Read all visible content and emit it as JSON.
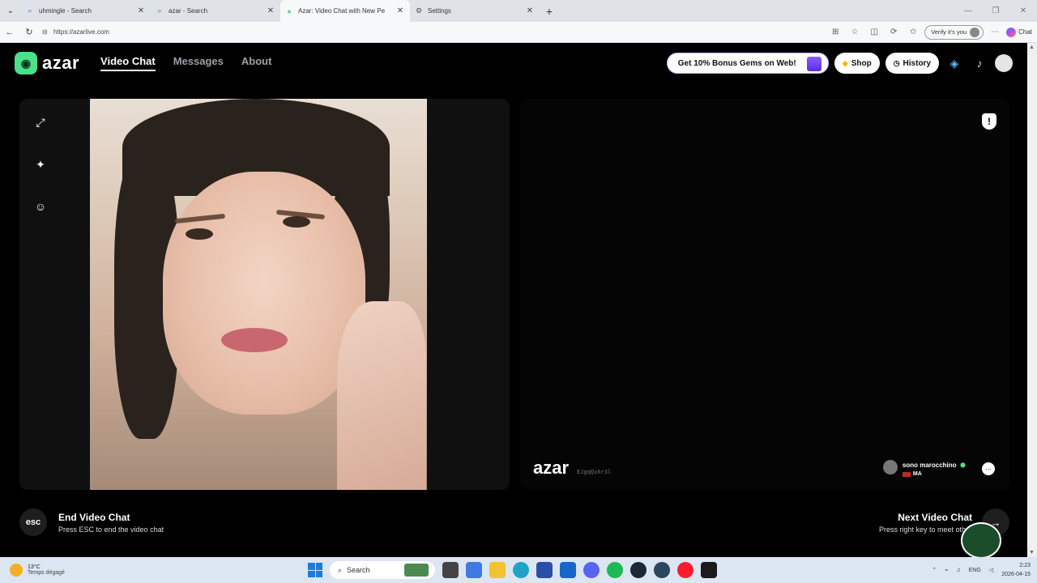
{
  "browser": {
    "tabs": [
      {
        "title": "uhmingle - Search",
        "icon": "search-icon",
        "active": false
      },
      {
        "title": "azar - Search",
        "icon": "search-icon",
        "active": false
      },
      {
        "title": "Azar: Video Chat with New Pe",
        "icon": "azar-favicon",
        "active": true
      },
      {
        "title": "Settings",
        "icon": "gear-icon",
        "active": false
      }
    ],
    "url": "https://azarlive.com",
    "verify_label": "Verify it's you",
    "chat_label": "Chat"
  },
  "site": {
    "logo": "azar",
    "nav": [
      {
        "label": "Video Chat",
        "active": true
      },
      {
        "label": "Messages",
        "active": false
      },
      {
        "label": "About",
        "active": false
      }
    ],
    "promo_label": "Get 10% Bonus Gems on Web!",
    "shop_label": "Shop",
    "history_label": "History"
  },
  "partner": {
    "watermark": "azar",
    "session_id": "EJgqQxhr3l",
    "name": "sono marocchino",
    "country": "MA"
  },
  "controls": {
    "end_key": "esc",
    "end_title": "End Video Chat",
    "end_hint": "Press ESC to end the video chat",
    "next_title": "Next Video Chat",
    "next_hint": "Press right key to meet other"
  },
  "taskbar": {
    "temperature": "13°C",
    "weather_desc": "Temps dégagé",
    "search_placeholder": "Search",
    "lang": "ENG",
    "time": "2:23",
    "date": "2026-04-15"
  },
  "colors": {
    "brand_green": "#4be08a",
    "page_bg": "#000000",
    "panel_bg": "#101010"
  }
}
